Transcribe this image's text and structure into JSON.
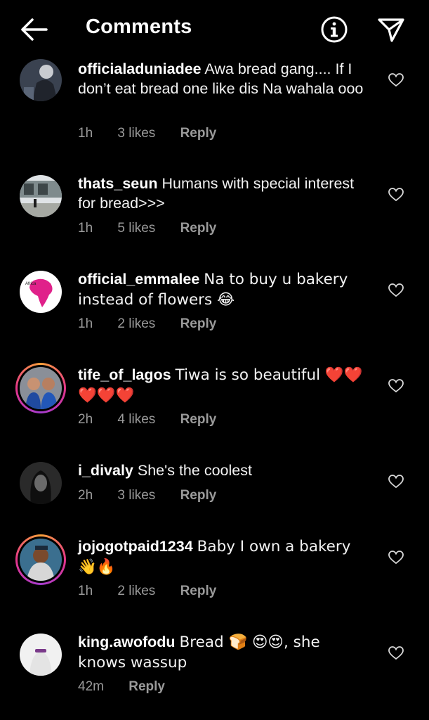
{
  "header": {
    "title": "Comments"
  },
  "icons": {
    "back": "arrow-left-icon",
    "info": "info-icon",
    "send": "paper-plane-icon",
    "like": "heart-outline-icon"
  },
  "colors": {
    "ring_gradient": [
      "#f9a13a",
      "#e5358a",
      "#a53ccf"
    ],
    "muted": "#9a9a9a"
  },
  "comments": [
    {
      "username": "officialaduniadee",
      "text": "Awa bread gang.... If I don’t eat bread one like dis Na wahala ooo",
      "time": "1h",
      "likes": "3 likes",
      "reply": "Reply"
    },
    {
      "username": "thats_seun",
      "text": "Humans with special interest for bread>>>",
      "time": "1h",
      "likes": "5 likes",
      "reply": "Reply"
    },
    {
      "username": "official_emmalee",
      "text": "Na to buy u bakery instead of flowers 😂",
      "time": "1h",
      "likes": "2 likes",
      "reply": "Reply",
      "avatar_text": "Africa"
    },
    {
      "username": "tife_of_lagos",
      "text": "Tiwa is so beautiful ❤️❤️❤️❤️❤️",
      "time": "2h",
      "likes": "4 likes",
      "reply": "Reply"
    },
    {
      "username": "i_divaly",
      "text": "She's the coolest",
      "time": "2h",
      "likes": "3 likes",
      "reply": "Reply"
    },
    {
      "username": "jojogotpaid1234",
      "text": "Baby I own a bakery 👋🔥",
      "time": "1h",
      "likes": "2 likes",
      "reply": "Reply"
    },
    {
      "username": "king.awofodu",
      "text": "Bread 🍞 😍😍, she knows wassup",
      "time": "42m",
      "likes": "",
      "reply": "Reply"
    }
  ]
}
